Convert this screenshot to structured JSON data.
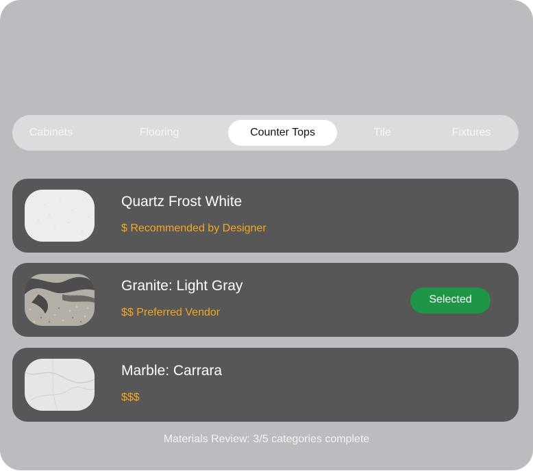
{
  "tabs": [
    {
      "label": "Cabinets",
      "active": false
    },
    {
      "label": "Flooring",
      "active": false
    },
    {
      "label": "Counter Tops",
      "active": true
    },
    {
      "label": "Tile",
      "active": false
    },
    {
      "label": "Fixtures",
      "active": false
    }
  ],
  "materials": [
    {
      "name": "Quartz Frost White",
      "price_note": "$ Recommended by Designer",
      "swatch": "quartz-white",
      "selected": false
    },
    {
      "name": "Granite: Light Gray",
      "price_note": "$$ Preferred Vendor",
      "swatch": "granite-gray",
      "selected": true,
      "badge": "Selected"
    },
    {
      "name": "Marble: Carrara",
      "price_note": "$$$",
      "swatch": "marble-carrara",
      "selected": false
    }
  ],
  "footer": {
    "status": "Materials Review: 3/5 categories complete"
  },
  "colors": {
    "panel": "#bbbcc0",
    "card": "#575757",
    "accent_orange": "#f5a623",
    "selected_green": "#1f9647"
  }
}
